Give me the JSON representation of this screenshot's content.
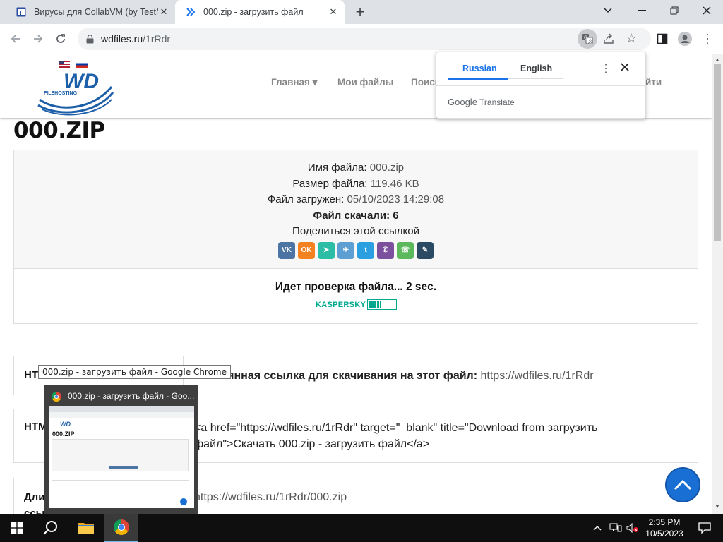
{
  "browser": {
    "tabs": [
      {
        "title": "Вирусы для CollabVM (by TestM"
      },
      {
        "title": "000.zip - загрузить файл"
      }
    ],
    "url_host": "wdfiles.ru",
    "url_path": "/1rRdr"
  },
  "translate": {
    "lang_from": "Russian",
    "lang_to": "English",
    "brand_google": "Google",
    "brand_translate": "Translate"
  },
  "site": {
    "logo_text": "WD",
    "logo_sub": "FILEHOSTING",
    "nav": [
      {
        "label": "Главная ▾"
      },
      {
        "label": "Мои файлы"
      },
      {
        "label": "Поиск"
      },
      {
        "label": "Войти"
      }
    ]
  },
  "file": {
    "title": "000.ZIP",
    "name_label": "Имя файла:",
    "name_value": "000.zip",
    "size_label": "Размер файла:",
    "size_value": "119.46 KB",
    "uploaded_label": "Файл загружен:",
    "uploaded_value": "05/10/2023 14:29:08",
    "downloads_text": "Файл скачали: 6",
    "share_text": "Поделиться этой ссылкой",
    "share_buttons": [
      {
        "name": "vk",
        "glyph": "VK",
        "color": "#4c75a3"
      },
      {
        "name": "odnoklassniki",
        "glyph": "OK",
        "color": "#f58220"
      },
      {
        "name": "livejournal-share",
        "glyph": "➤",
        "color": "#2bbda5"
      },
      {
        "name": "telegram",
        "glyph": "✈",
        "color": "#5e9fd3"
      },
      {
        "name": "twitter",
        "glyph": "t",
        "color": "#2b9fe0"
      },
      {
        "name": "viber",
        "glyph": "✆",
        "color": "#7b519d"
      },
      {
        "name": "whatsapp",
        "glyph": "☏",
        "color": "#5cb85c"
      },
      {
        "name": "blogger-edit",
        "glyph": "✎",
        "color": "#2a4b63"
      }
    ],
    "check_text": "Идет проверка файла... 2 sec.",
    "kaspersky": "KASPERSKY",
    "kaspersky_progress": 0.45
  },
  "links": [
    {
      "label": "HTML-ссылка",
      "value_bold": "Постоянная ссылка для скачивания на этот файл:",
      "value": "https://wdfiles.ru/1rRdr"
    },
    {
      "label": "HTML-код",
      "value1": "<a href=\"https://wdfiles.ru/1rRdr\" target=\"_blank\" title=\"Download from загрузить",
      "value2": "файл\">Скачать 000.zip - загрузить файл</a>"
    },
    {
      "label": "Длинная ссылка на файл",
      "value": "https://wdfiles.ru/1rRdr/000.zip"
    }
  ],
  "taskbar_tooltip": "000.zip - загрузить файл - Google Chrome",
  "thumbnail_title": "000.zip - загрузить файл - Goo...",
  "clock": {
    "time": "2:35 PM",
    "date": "10/5/2023"
  }
}
